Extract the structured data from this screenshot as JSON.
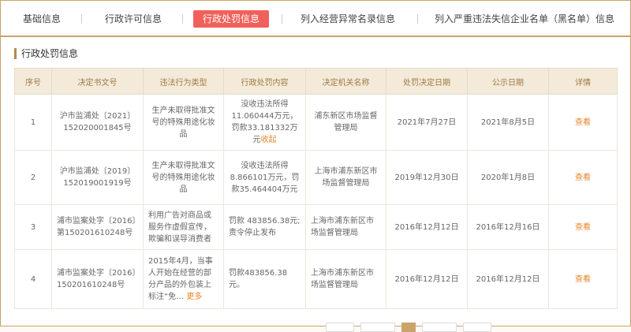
{
  "tabs": [
    {
      "label": "基础信息"
    },
    {
      "label": "行政许可信息"
    },
    {
      "label": "行政处罚信息"
    },
    {
      "label": "列入经营异常名录信息"
    },
    {
      "label": "列入严重违法失信企业名单（黑名单）信息"
    }
  ],
  "section_title": "行政处罚信息",
  "table": {
    "headers": [
      "序号",
      "决定书文号",
      "违法行为类型",
      "行政处罚内容",
      "决定机关名称",
      "处罚决定日期",
      "公示日期",
      "详情"
    ],
    "rows": [
      {
        "no": "1",
        "doc": "沪市监浦处〔2021〕152020001845号",
        "type": "生产未取得批准文号的特殊用途化妆品",
        "content": "没收违法所得11.060444万元，罚款33.181332万元",
        "more": "收起",
        "org": "浦东新区市场监督管理局",
        "decision_date": "2021年7月27日",
        "pub_date": "2021年8月5日",
        "detail": "查看"
      },
      {
        "no": "2",
        "doc": "沪市监浦处〔2019〕152019001919号",
        "type": "生产未取得批准文号的特殊用途化妆品",
        "content": "没收违法所得8.866101万元，罚款35.464404万元",
        "more": "",
        "org": "上海市浦东新区市场监督管理局",
        "decision_date": "2019年12月30日",
        "pub_date": "2020年1月8日",
        "detail": "查看"
      },
      {
        "no": "3",
        "doc": "浦市监案处字〔2016〕第150201610248号",
        "type": "利用广告对商品或服务作虚假宣传，欺骗和误导消费者",
        "content": "罚款 483856.38元;责令停止发布",
        "more": "",
        "org": "上海市浦东新区市场监督管理局",
        "decision_date": "2016年12月12日",
        "pub_date": "2016年12月16日",
        "detail": "查看"
      },
      {
        "no": "4",
        "doc": "浦市监案处字〔2016〕150201610248号",
        "type": "2015年4月，当事人开始在经营的部分产品的外包装上标注“免…",
        "content": "罚款483856.38元。",
        "more": "更多",
        "org": "上海市浦东新区市场监督管理局",
        "decision_date": "2016年12月12日",
        "pub_date": "2016年12月12日",
        "detail": "查看"
      }
    ]
  }
}
